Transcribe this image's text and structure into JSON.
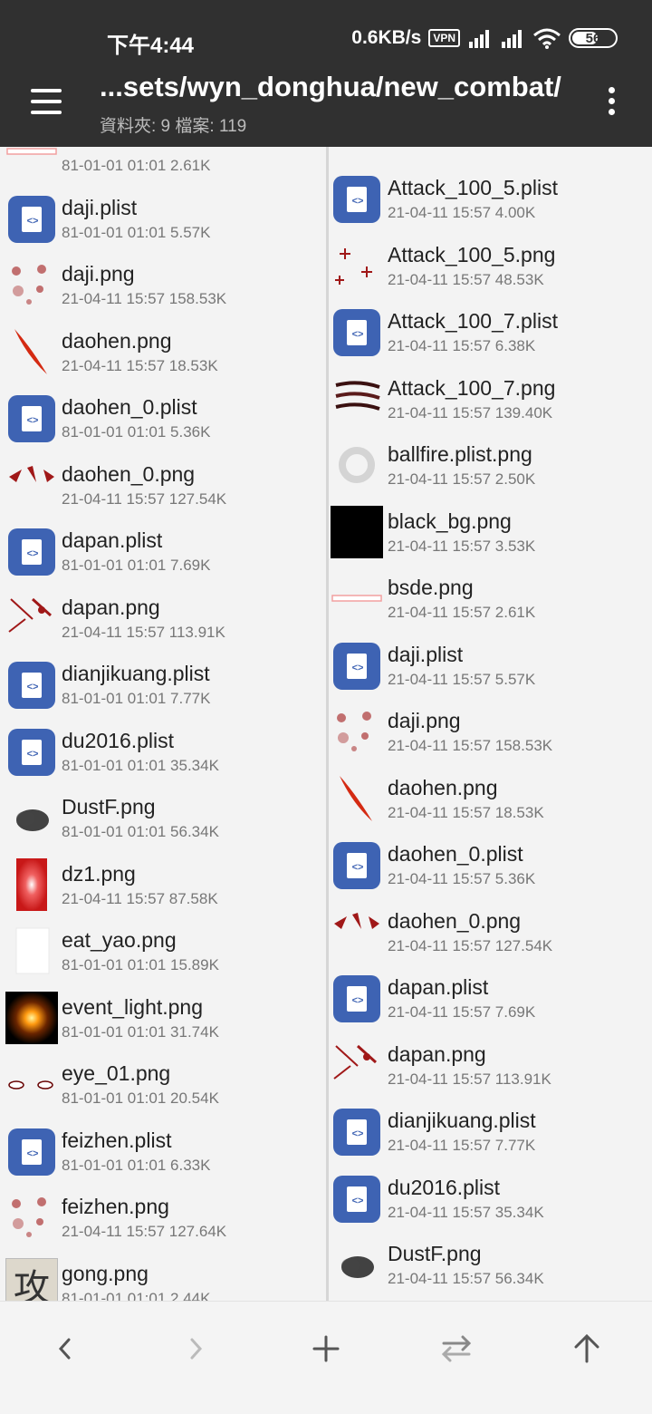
{
  "status": {
    "time": "下午4:44",
    "net_speed": "0.6KB/s",
    "vpn": "VPN",
    "hd": "HD",
    "battery": "56"
  },
  "header": {
    "path": "...sets/wyn_donghua/new_combat/",
    "summary": "資料夾: 9  檔案: 119"
  },
  "left_files": [
    {
      "name": "",
      "meta": "81-01-01 01:01  2.61K",
      "thumb": "bsde"
    },
    {
      "name": "daji.plist",
      "meta": "81-01-01 01:01  5.57K",
      "thumb": "code"
    },
    {
      "name": "daji.png",
      "meta": "21-04-11 15:57  158.53K",
      "thumb": "daji"
    },
    {
      "name": "daohen.png",
      "meta": "21-04-11 15:57  18.53K",
      "thumb": "slash"
    },
    {
      "name": "daohen_0.plist",
      "meta": "81-01-01 01:01  5.36K",
      "thumb": "code"
    },
    {
      "name": "daohen_0.png",
      "meta": "21-04-11 15:57  127.54K",
      "thumb": "splat"
    },
    {
      "name": "dapan.plist",
      "meta": "81-01-01 01:01  7.69K",
      "thumb": "code"
    },
    {
      "name": "dapan.png",
      "meta": "21-04-11 15:57  113.91K",
      "thumb": "dapan"
    },
    {
      "name": "dianjikuang.plist",
      "meta": "81-01-01 01:01  7.77K",
      "thumb": "code"
    },
    {
      "name": "du2016.plist",
      "meta": "81-01-01 01:01  35.34K",
      "thumb": "code"
    },
    {
      "name": "DustF.png",
      "meta": "81-01-01 01:01  56.34K",
      "thumb": "dust"
    },
    {
      "name": "dz1.png",
      "meta": "21-04-11 15:57  87.58K",
      "thumb": "dz1"
    },
    {
      "name": "eat_yao.png",
      "meta": "81-01-01 01:01  15.89K",
      "thumb": "blank"
    },
    {
      "name": "event_light.png",
      "meta": "81-01-01 01:01  31.74K",
      "thumb": "light"
    },
    {
      "name": "eye_01.png",
      "meta": "81-01-01 01:01  20.54K",
      "thumb": "eye"
    },
    {
      "name": "feizhen.plist",
      "meta": "81-01-01 01:01  6.33K",
      "thumb": "code"
    },
    {
      "name": "feizhen.png",
      "meta": "21-04-11 15:57  127.64K",
      "thumb": "daji"
    },
    {
      "name": "gong.png",
      "meta": "81-01-01 01:01  2.44K",
      "thumb": "gong"
    }
  ],
  "right_files": [
    {
      "name": "Attack_100_5.plist",
      "meta": "21-04-11 15:57  4.00K",
      "thumb": "code"
    },
    {
      "name": "Attack_100_5.png",
      "meta": "21-04-11 15:57  48.53K",
      "thumb": "sparks"
    },
    {
      "name": "Attack_100_7.plist",
      "meta": "21-04-11 15:57  6.38K",
      "thumb": "code"
    },
    {
      "name": "Attack_100_7.png",
      "meta": "21-04-11 15:57  139.40K",
      "thumb": "claw"
    },
    {
      "name": "ballfire.plist.png",
      "meta": "21-04-11 15:57  2.50K",
      "thumb": "ring"
    },
    {
      "name": "black_bg.png",
      "meta": "21-04-11 15:57  3.53K",
      "thumb": "black"
    },
    {
      "name": "bsde.png",
      "meta": "21-04-11 15:57  2.61K",
      "thumb": "bsde"
    },
    {
      "name": "daji.plist",
      "meta": "21-04-11 15:57  5.57K",
      "thumb": "code"
    },
    {
      "name": "daji.png",
      "meta": "21-04-11 15:57  158.53K",
      "thumb": "daji"
    },
    {
      "name": "daohen.png",
      "meta": "21-04-11 15:57  18.53K",
      "thumb": "slash"
    },
    {
      "name": "daohen_0.plist",
      "meta": "21-04-11 15:57  5.36K",
      "thumb": "code"
    },
    {
      "name": "daohen_0.png",
      "meta": "21-04-11 15:57  127.54K",
      "thumb": "splat"
    },
    {
      "name": "dapan.plist",
      "meta": "21-04-11 15:57  7.69K",
      "thumb": "code"
    },
    {
      "name": "dapan.png",
      "meta": "21-04-11 15:57  113.91K",
      "thumb": "dapan"
    },
    {
      "name": "dianjikuang.plist",
      "meta": "21-04-11 15:57  7.77K",
      "thumb": "code"
    },
    {
      "name": "du2016.plist",
      "meta": "21-04-11 15:57  35.34K",
      "thumb": "code"
    },
    {
      "name": "DustF.png",
      "meta": "21-04-11 15:57  56.34K",
      "thumb": "dust"
    }
  ],
  "code_glyph": "<>",
  "gong_glyph": "攻",
  "bottom_nav": [
    {
      "id": "back",
      "icon": "chevron-left-icon"
    },
    {
      "id": "forward",
      "icon": "chevron-right-icon"
    },
    {
      "id": "add",
      "icon": "plus-icon"
    },
    {
      "id": "swap",
      "icon": "swap-icon"
    },
    {
      "id": "up",
      "icon": "arrow-up-icon"
    }
  ],
  "colors": {
    "header_bg": "#303030",
    "code_icon": "#3e63b3",
    "blood_red": "#a01818"
  }
}
